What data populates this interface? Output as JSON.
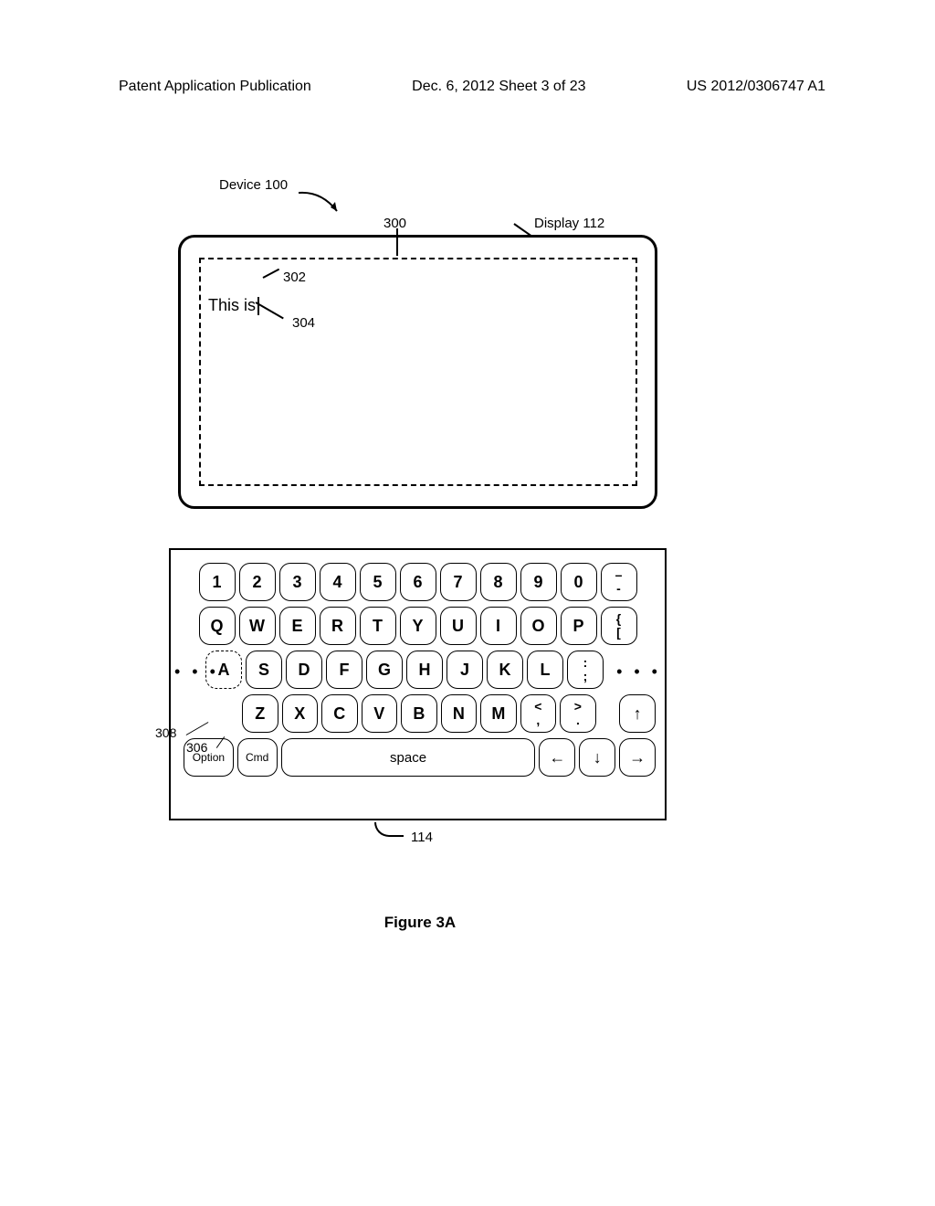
{
  "header": {
    "left": "Patent Application Publication",
    "center": "Dec. 6, 2012  Sheet 3 of 23",
    "right": "US 2012/0306747 A1"
  },
  "labels": {
    "device": "Device 100",
    "display": "Display 112",
    "ref_300": "300",
    "ref_302": "302",
    "ref_304": "304",
    "ref_306": "306",
    "ref_308": "308",
    "ref_114": "114"
  },
  "text_content": "This is",
  "keyboard": {
    "row1": [
      "1",
      "2",
      "3",
      "4",
      "5",
      "6",
      "7",
      "8",
      "9",
      "0",
      "–\n-"
    ],
    "row2": [
      "Q",
      "W",
      "E",
      "R",
      "T",
      "Y",
      "U",
      "I",
      "O",
      "P",
      "{\n["
    ],
    "row3": [
      "A",
      "S",
      "D",
      "F",
      "G",
      "H",
      "J",
      "K",
      "L",
      ":\n;"
    ],
    "row4": [
      "Z",
      "X",
      "C",
      "V",
      "B",
      "N",
      "M",
      "<\n,",
      ">\n.",
      "↑"
    ],
    "row5_option": "Option",
    "row5_cmd": "Cmd",
    "row5_space": "space",
    "row5_left": "←",
    "row5_down": "↓",
    "row5_right": "→",
    "ellipsis": "• • •"
  },
  "figure_title": "Figure 3A"
}
